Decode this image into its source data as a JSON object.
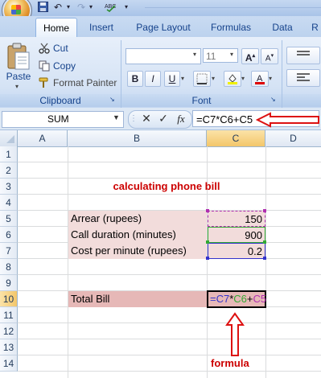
{
  "ribbon": {
    "tabs": [
      "Home",
      "Insert",
      "Page Layout",
      "Formulas",
      "Data",
      "R"
    ],
    "active_tab": "Home",
    "clipboard": {
      "paste": "Paste",
      "cut": "Cut",
      "copy": "Copy",
      "format_painter": "Format Painter",
      "group_label": "Clipboard"
    },
    "font": {
      "font_name": "",
      "font_size": "11",
      "group_label": "Font",
      "bold": "B",
      "italic": "I",
      "underline": "U"
    }
  },
  "formula_bar": {
    "name_box": "SUM",
    "fx": "fx",
    "formula": "=C7*C6+C5"
  },
  "grid": {
    "columns": [
      "A",
      "B",
      "C",
      "D"
    ],
    "rows": [
      "1",
      "2",
      "3",
      "4",
      "5",
      "6",
      "7",
      "8",
      "9",
      "10",
      "11",
      "12",
      "13",
      "14"
    ],
    "title": "calculating phone bill",
    "labels": {
      "arrear": "Arrear (rupees)",
      "call_duration": "Call duration (minutes)",
      "cost_per_minute": "Cost per  minute (rupees)",
      "total_bill": "Total Bill"
    },
    "values": {
      "arrear": "150",
      "call_duration": "900",
      "cost_per_minute": "0.2"
    },
    "edit_formula": {
      "eq": "=",
      "c7": "C7",
      "op1": "*",
      "c6": "C6",
      "op2": "+",
      "c5": "C5"
    },
    "annotation": "formula"
  },
  "colors": {
    "ribbon_blue": "#15428b",
    "title_red": "#cc0000",
    "label_fill": "#f2dcdb",
    "total_fill": "#e6b8b7",
    "ref_c7": "#3333cc",
    "ref_c6": "#33aa33",
    "ref_c5": "#b030b0",
    "arrow_red": "#dd1111"
  }
}
